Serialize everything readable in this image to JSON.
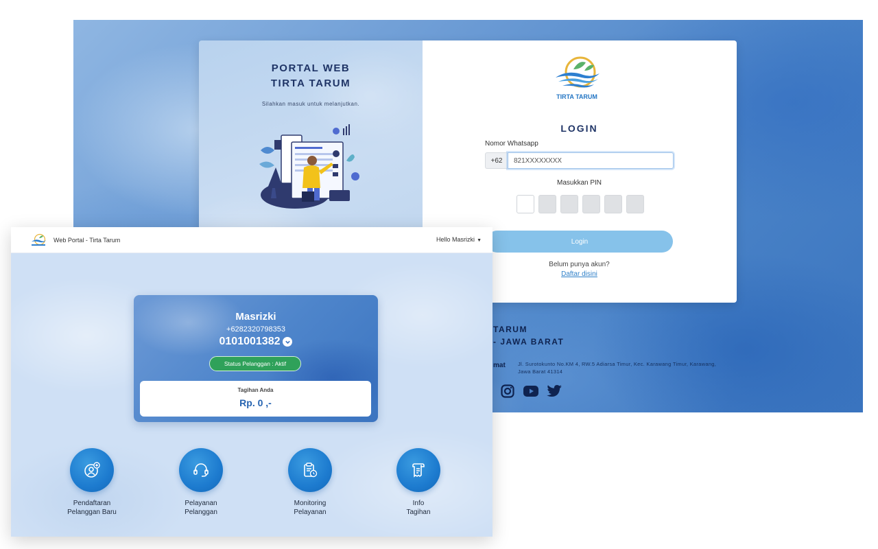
{
  "login_page": {
    "portal_title_line1": "PORTAL WEB",
    "portal_title_line2": "TIRTA TARUM",
    "portal_subtitle": "Silahkan masuk untuk melanjutkan.",
    "logo_text": "TIRTA TARUM",
    "login_title": "LOGIN",
    "whatsapp_label": "Nomor Whatsapp",
    "phone_prefix": "+62",
    "phone_placeholder": "821XXXXXXXX",
    "pin_label": "Masukkan PIN",
    "pin_length": 6,
    "login_button": "Login",
    "no_account_text": "Belum punya akun?",
    "register_link": "Daftar disini",
    "colors": {
      "accent": "#86c2ea",
      "title": "#1f3466",
      "link": "#2f80c8"
    }
  },
  "footer": {
    "name_line1": "TARUM",
    "name_line2": "- JAWA BARAT",
    "address_label": "mat",
    "address": "Jl. Surotokunto No.KM 4, RW.5 Adiarsa Timur, Kec. Karawang Timur, Karawang, Jawa Barat 41314",
    "social_icons": [
      "instagram-icon",
      "youtube-icon",
      "twitter-icon"
    ]
  },
  "dashboard": {
    "nav_title": "Web Portal - Tirta Tarum",
    "nav_user": "Hello Masrizki",
    "profile": {
      "name": "Masrizki",
      "phone": "+6282320798353",
      "customer_id": "0101001382",
      "status": "Status Pelanggan : Aktif",
      "bill_label": "Tagihan Anda",
      "bill_amount": "Rp. 0 ,-"
    },
    "menu": [
      {
        "line1": "Pendaftaran",
        "line2": "Pelanggan Baru",
        "icon": "add-user-icon"
      },
      {
        "line1": "Pelayanan",
        "line2": "Pelanggan",
        "icon": "headset-icon"
      },
      {
        "line1": "Monitoring",
        "line2": "Pelayanan",
        "icon": "clipboard-clock-icon"
      },
      {
        "line1": "Info",
        "line2": "Tagihan",
        "icon": "receipt-icon"
      }
    ],
    "colors": {
      "status_green": "#2fa15a",
      "menu_blue": "#1d7bcf",
      "bill_blue": "#2563b0"
    }
  }
}
